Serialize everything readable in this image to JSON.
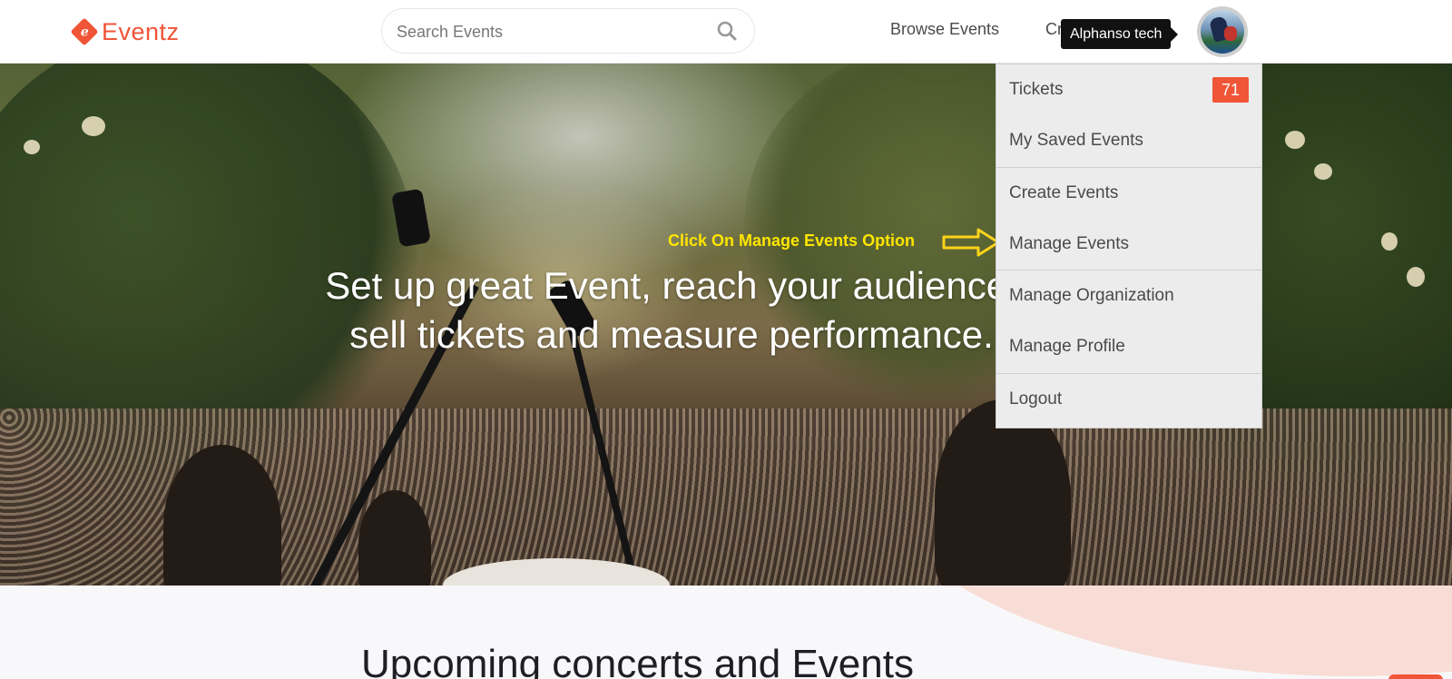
{
  "header": {
    "logo_mark": "e",
    "logo_text": "Eventz",
    "search_placeholder": "Search Events",
    "nav_browse": "Browse Events",
    "nav_create": "Cr",
    "tooltip": "Alphanso tech"
  },
  "hero": {
    "title_line1": "Set up great Event, reach your audience,",
    "title_line2": "sell tickets and measure performance."
  },
  "annotation": {
    "text": "Click On Manage Events Option",
    "color": "#ffe500"
  },
  "dropdown": {
    "items": [
      {
        "label": "Tickets",
        "badge": "71"
      },
      {
        "label": "My Saved Events"
      },
      {
        "label": "Create Events"
      },
      {
        "label": "Manage Events"
      },
      {
        "label": "Manage Organization"
      },
      {
        "label": "Manage Profile"
      },
      {
        "label": "Logout"
      }
    ]
  },
  "section": {
    "heading": "Upcoming concerts and Events"
  },
  "colors": {
    "brand": "#f05537",
    "dropdown_bg": "#ececec"
  },
  "icons": [
    "search-icon",
    "arrow-right-icon",
    "logo-icon"
  ]
}
